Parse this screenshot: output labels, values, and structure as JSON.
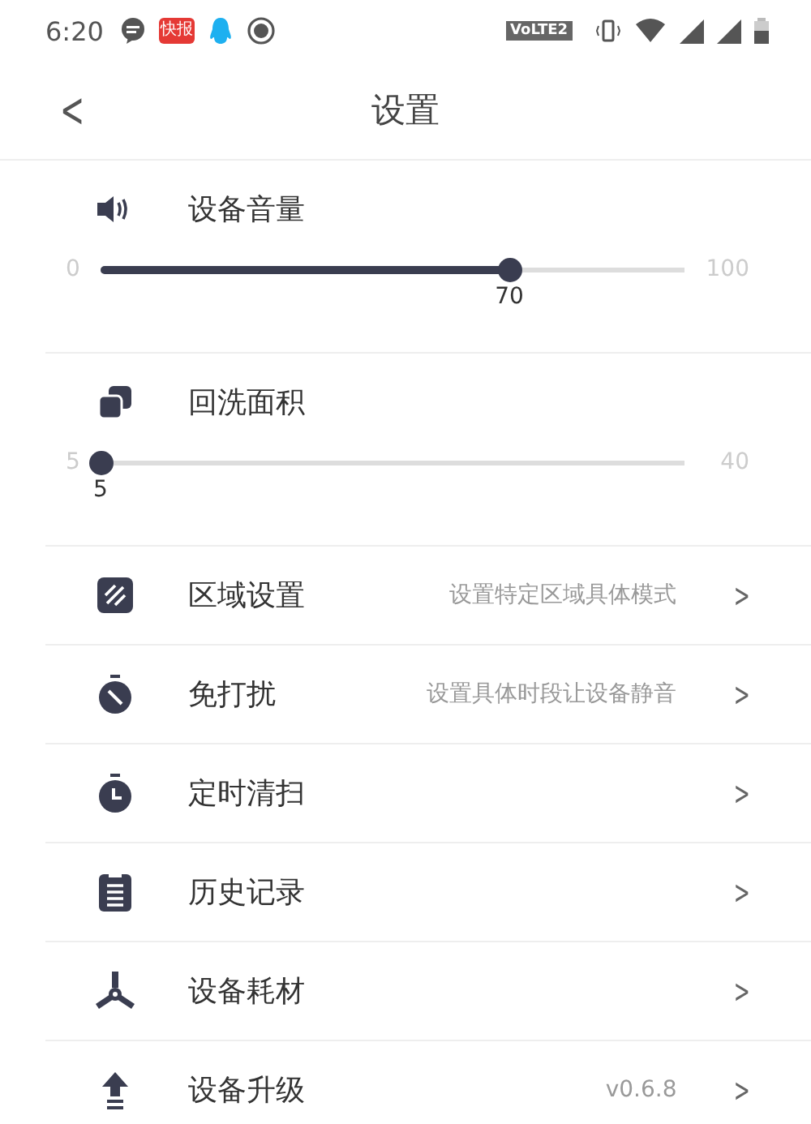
{
  "status_bar": {
    "time": "6:20",
    "app_badge": "快报",
    "network_badge": "VoLTE2"
  },
  "header": {
    "back": "<",
    "title": "设置"
  },
  "settings": [
    {
      "kind": "slider",
      "label": "设备音量",
      "min": "0",
      "max": "100",
      "value": "70",
      "level": 0.7
    },
    {
      "kind": "slider",
      "label": "回洗面积",
      "min": "5",
      "max": "40",
      "value": "5",
      "level": 0
    },
    {
      "kind": "link",
      "label": "区域设置",
      "detail": "设置特定区域具体模式",
      "chevron": ">"
    },
    {
      "kind": "link",
      "label": "免打扰",
      "detail": "设置具体时段让设备静音",
      "chevron": ">"
    },
    {
      "kind": "link",
      "label": "定时清扫",
      "chevron": ">"
    },
    {
      "kind": "link",
      "label": "历史记录",
      "chevron": ">"
    },
    {
      "kind": "link",
      "label": "设备耗材",
      "chevron": ">"
    },
    {
      "kind": "link",
      "label": "设备升级",
      "detail": "v0.6.8",
      "chevron": ">"
    }
  ]
}
